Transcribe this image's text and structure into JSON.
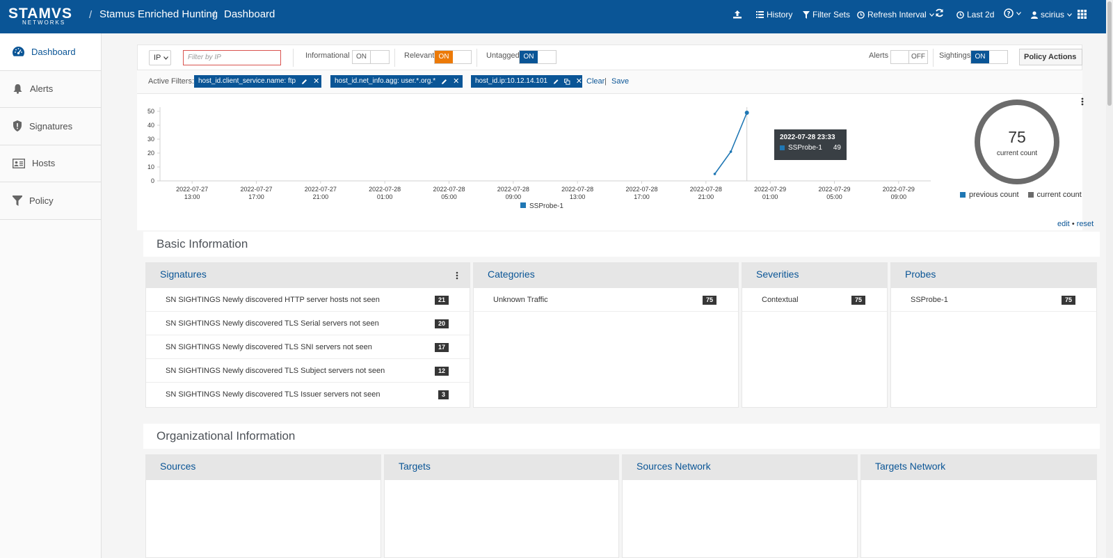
{
  "header": {
    "logo_text": "STAMVS",
    "logo_sub": "NETWORKS",
    "breadcrumb": [
      "Stamus Enriched Hunting",
      "Dashboard"
    ],
    "upload_icon": "upload-icon",
    "history": "History",
    "filter_sets": "Filter Sets",
    "refresh_interval": "Refresh Interval",
    "last": "Last 2d",
    "user": "scirius"
  },
  "sidebar": {
    "items": [
      {
        "label": "Dashboard",
        "icon": "dashboard-icon",
        "active": true
      },
      {
        "label": "Alerts",
        "icon": "bell-icon"
      },
      {
        "label": "Signatures",
        "icon": "shield-icon"
      },
      {
        "label": "Hosts",
        "icon": "id-card-icon"
      },
      {
        "label": "Policy",
        "icon": "funnel-icon"
      }
    ]
  },
  "filterbar": {
    "ip_select": "IP",
    "ip_placeholder": "Filter by IP",
    "informational": {
      "label": "Informational",
      "state": "ON"
    },
    "relevant": {
      "label": "Relevant",
      "state": "ON"
    },
    "untagged": {
      "label": "Untagged",
      "state": "ON"
    },
    "alerts": {
      "label": "Alerts",
      "state": "OFF"
    },
    "sightings": {
      "label": "Sightings",
      "state": "ON"
    },
    "policy_actions": "Policy Actions"
  },
  "active_filters": {
    "label": "Active Filters:",
    "chips": [
      "host_id.client_service.name: ftp",
      "host_id.net_info.agg: user.*.org.*",
      "host_id.ip:10.12.14.101"
    ],
    "clear": "Clear",
    "separator": "|",
    "save": "Save"
  },
  "chart_data": {
    "type": "line",
    "x_ticks": [
      [
        "2022-07-27",
        "13:00"
      ],
      [
        "2022-07-27",
        "17:00"
      ],
      [
        "2022-07-27",
        "21:00"
      ],
      [
        "2022-07-28",
        "01:00"
      ],
      [
        "2022-07-28",
        "05:00"
      ],
      [
        "2022-07-28",
        "09:00"
      ],
      [
        "2022-07-28",
        "13:00"
      ],
      [
        "2022-07-28",
        "17:00"
      ],
      [
        "2022-07-28",
        "21:00"
      ],
      [
        "2022-07-29",
        "01:00"
      ],
      [
        "2022-07-29",
        "05:00"
      ],
      [
        "2022-07-29",
        "09:00"
      ]
    ],
    "y_ticks": [
      0,
      10,
      20,
      30,
      40,
      50
    ],
    "ylim": [
      0,
      50
    ],
    "series": [
      {
        "name": "SSProbe-1",
        "color": "#1f77b4",
        "points": [
          {
            "x": "2022-07-28 21:33",
            "y": 5
          },
          {
            "x": "2022-07-28 22:33",
            "y": 21
          },
          {
            "x": "2022-07-28 23:33",
            "y": 49
          }
        ]
      }
    ],
    "tooltip": {
      "title": "2022-07-28 23:33",
      "series": "SSProbe-1",
      "value": "49"
    },
    "legend": "bottom"
  },
  "donut": {
    "value": "75",
    "label": "current count",
    "legend": [
      {
        "label": "previous count",
        "color": "#1f77b4"
      },
      {
        "label": "current count",
        "color": "#6b6b6b"
      }
    ],
    "links": {
      "edit": "edit",
      "dot": "•",
      "reset": "reset"
    }
  },
  "basic_info": {
    "title": "Basic Information",
    "signatures": {
      "title": "Signatures",
      "rows": [
        {
          "label": "SN SIGHTINGS Newly discovered HTTP server hosts not seen",
          "count": "21"
        },
        {
          "label": "SN SIGHTINGS Newly discovered TLS Serial servers not seen",
          "count": "20"
        },
        {
          "label": "SN SIGHTINGS Newly discovered TLS SNI servers not seen",
          "count": "17"
        },
        {
          "label": "SN SIGHTINGS Newly discovered TLS Subject servers not seen",
          "count": "12"
        },
        {
          "label": "SN SIGHTINGS Newly discovered TLS Issuer servers not seen",
          "count": "3"
        }
      ]
    },
    "categories": {
      "title": "Categories",
      "rows": [
        {
          "label": "Unknown Traffic",
          "count": "75"
        }
      ]
    },
    "severities": {
      "title": "Severities",
      "rows": [
        {
          "label": "Contextual",
          "count": "75"
        }
      ]
    },
    "probes": {
      "title": "Probes",
      "rows": [
        {
          "label": "SSProbe-1",
          "count": "75"
        }
      ]
    }
  },
  "org_info": {
    "title": "Organizational Information",
    "panels": [
      "Sources",
      "Targets",
      "Sources Network",
      "Targets Network"
    ]
  }
}
